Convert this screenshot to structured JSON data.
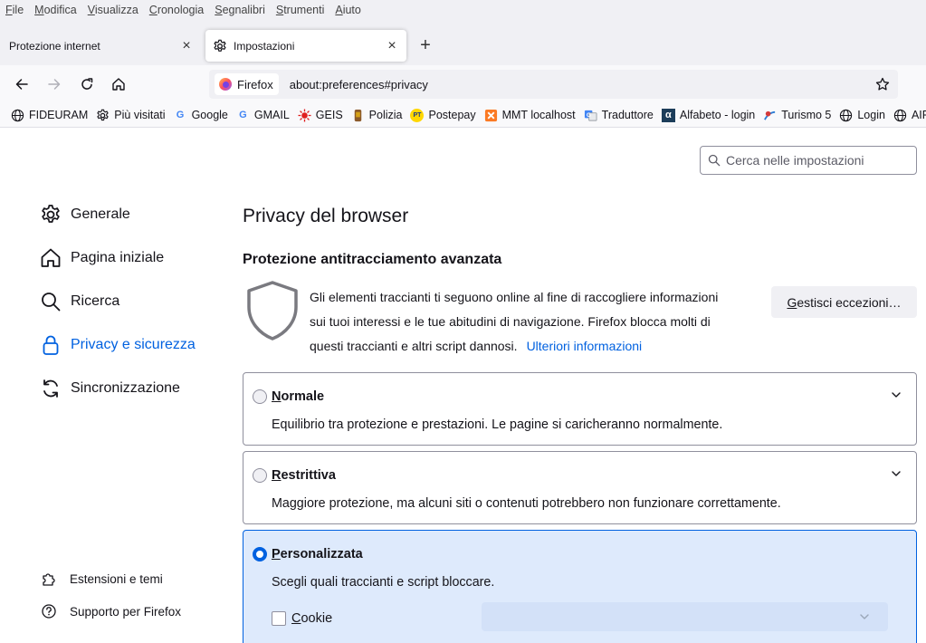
{
  "menu": [
    {
      "accel": "F",
      "rest": "ile"
    },
    {
      "accel": "M",
      "rest": "odifica"
    },
    {
      "accel": "V",
      "rest": "isualizza"
    },
    {
      "accel": "C",
      "rest": "ronologia"
    },
    {
      "accel": "S",
      "rest": "egnalibri"
    },
    {
      "accel": "S",
      "rest": "trumenti"
    },
    {
      "accel": "A",
      "rest": "iuto"
    }
  ],
  "tabs": {
    "inactive_label": "Protezione internet",
    "active_label": "Impostazioni",
    "close_glyph": "×",
    "new_tab_glyph": "+"
  },
  "navbar": {
    "identity_label": "Firefox",
    "url": "about:preferences#privacy"
  },
  "bookmarks": [
    {
      "label": "FIDEURAM",
      "icon": "globe-icon"
    },
    {
      "label": "Più visitati",
      "icon": "gear-icon"
    },
    {
      "label": "Google",
      "icon": "google-icon"
    },
    {
      "label": "GMAIL",
      "icon": "google-icon"
    },
    {
      "label": "GEIS",
      "icon": "sun-icon"
    },
    {
      "label": "Polizia",
      "icon": "police-icon"
    },
    {
      "label": "Postepay",
      "icon": "postepay-icon"
    },
    {
      "label": "MMT localhost",
      "icon": "xampp-icon"
    },
    {
      "label": "Traduttore",
      "icon": "translate-icon"
    },
    {
      "label": "Alfabeto - login",
      "icon": "alpha-icon"
    },
    {
      "label": "Turismo 5",
      "icon": "turismo-icon"
    },
    {
      "label": "Login",
      "icon": "globe-icon"
    },
    {
      "label": "AIR",
      "icon": "globe-icon"
    }
  ],
  "search": {
    "placeholder": "Cerca nelle impostazioni"
  },
  "categories": {
    "general": "Generale",
    "home": "Pagina iniziale",
    "search": "Ricerca",
    "privacy": "Privacy e sicurezza",
    "sync": "Sincronizzazione"
  },
  "footer": {
    "extensions": "Estensioni e temi",
    "support": "Supporto per Firefox"
  },
  "main": {
    "title": "Privacy del browser",
    "etp_heading": "Protezione antitracciamento avanzata",
    "etp_desc_line1": "Gli elementi traccianti ti seguono online al fine di raccogliere informazioni",
    "etp_desc_line2": "sui tuoi interessi e le tue abitudini di navigazione. Firefox blocca molti di",
    "etp_desc_line3": "questi traccianti e altri script dannosi.",
    "learn_more": "Ulteriori informazioni",
    "exceptions_accel": "G",
    "exceptions_rest": "estisci eccezioni…",
    "options": {
      "standard": {
        "accel": "N",
        "rest": "ormale",
        "desc": "Equilibrio tra protezione e prestazioni. Le pagine si caricheranno normalmente."
      },
      "strict": {
        "accel": "R",
        "rest": "estrittiva",
        "desc": "Maggiore protezione, ma alcuni siti o contenuti potrebbero non funzionare correttamente."
      },
      "custom": {
        "accel": "P",
        "rest": "ersonalizzata",
        "desc": "Scegli quali traccianti e script bloccare."
      }
    },
    "cookie_accel": "C",
    "cookie_rest": "ookie"
  },
  "colors": {
    "accent": "#0061e0",
    "selected_bg": "#deeafc"
  }
}
